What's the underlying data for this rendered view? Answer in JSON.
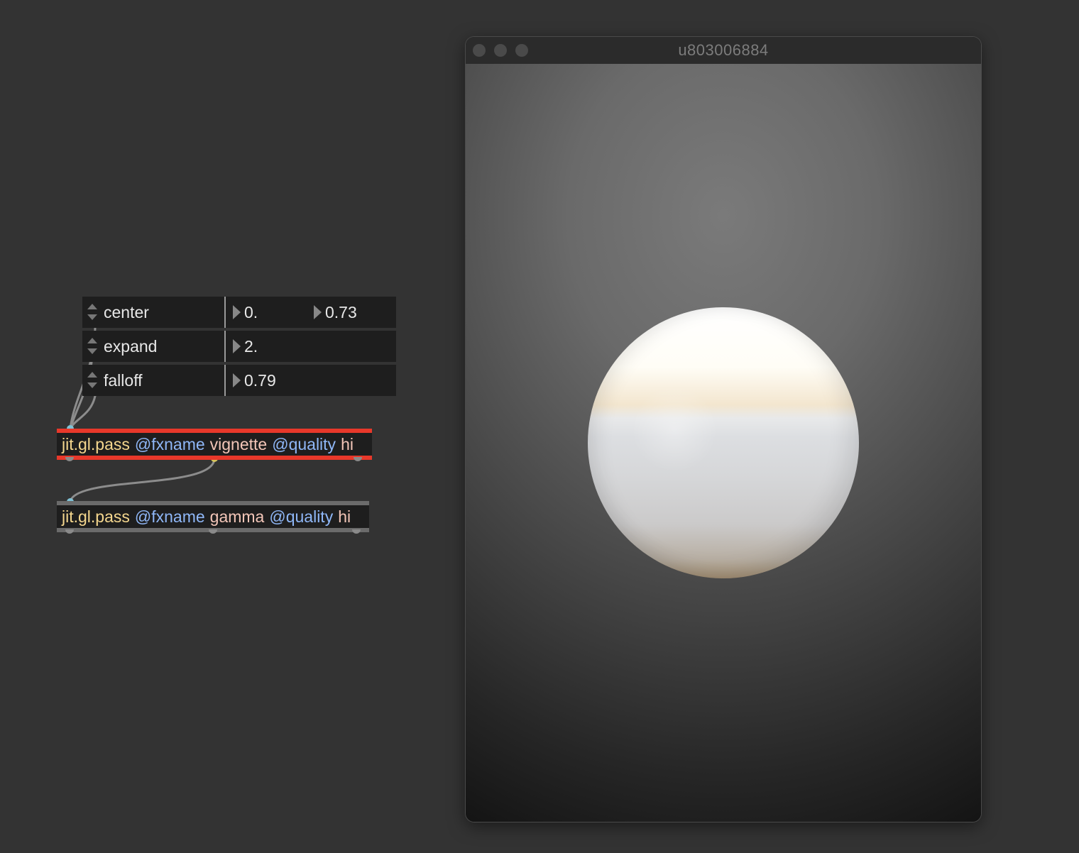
{
  "patcher": {
    "attrui": [
      {
        "name": "center",
        "values": [
          "0.",
          "0.73"
        ]
      },
      {
        "name": "expand",
        "values": [
          "2."
        ]
      },
      {
        "name": "falloff",
        "values": [
          "0.79"
        ]
      }
    ],
    "objects": [
      {
        "class": "jit.gl.pass",
        "attr1": "@fxname",
        "val1": "vignette",
        "attr2": "@quality",
        "val2": "hi",
        "state": "selected-error"
      },
      {
        "class": "jit.gl.pass",
        "attr1": "@fxname",
        "val1": "gamma",
        "attr2": "@quality",
        "val2": "hi",
        "state": "normal"
      }
    ]
  },
  "window": {
    "title": "u803006884",
    "traffic_lights": [
      "close",
      "minimize",
      "zoom"
    ]
  },
  "colors": {
    "background": "#333333",
    "error_border": "#e8382a",
    "class_text": "#f5d78e",
    "attr_text": "#8fb7f7",
    "value_text": "#f3c6b8"
  }
}
